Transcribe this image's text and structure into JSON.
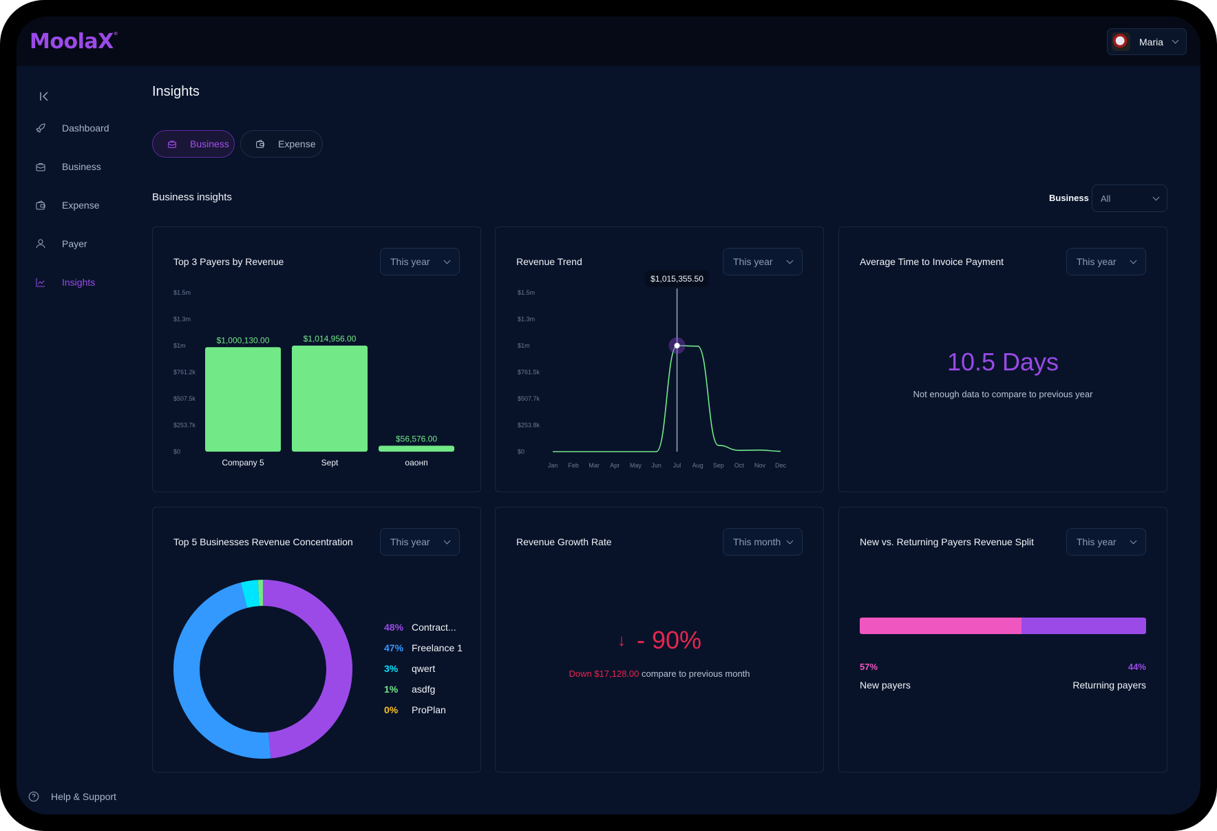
{
  "app": {
    "logo": "MoolaX",
    "logo_mark": "®"
  },
  "user": {
    "name": "Maria"
  },
  "sidebar": {
    "items": [
      {
        "label": "Dashboard",
        "icon": "rocket-icon"
      },
      {
        "label": "Business",
        "icon": "briefcase-icon"
      },
      {
        "label": "Expense",
        "icon": "wallet-icon"
      },
      {
        "label": "Payer",
        "icon": "user-icon"
      },
      {
        "label": "Insights",
        "icon": "trend-chart-icon",
        "active": true
      }
    ],
    "help_label": "Help & Support"
  },
  "page": {
    "title": "Insights",
    "tabs": [
      {
        "label": "Business",
        "active": true
      },
      {
        "label": "Expense",
        "active": false
      }
    ],
    "section_title": "Business insights",
    "filter_label": "Business",
    "filter_value": "All"
  },
  "colors": {
    "accent": "#9b4ae8",
    "bar_green": "#72e887",
    "down_red": "#e8264f",
    "pink": "#f056c0",
    "blue": "#3399ff",
    "cyan": "#00e5ff",
    "yellow": "#ffc21a"
  },
  "cards": {
    "top_payers": {
      "title": "Top 3 Payers by Revenue",
      "period": "This year"
    },
    "revenue_trend": {
      "title": "Revenue Trend",
      "period": "This year"
    },
    "avg_time": {
      "title": "Average Time to Invoice Payment",
      "period": "This year",
      "value": "10.5 Days",
      "note": "Not enough data to compare to previous year"
    },
    "concentration": {
      "title": "Top 5 Businesses Revenue Concentration",
      "period": "This year"
    },
    "growth": {
      "title": "Revenue Growth Rate",
      "period": "This month",
      "arrow": "↓",
      "value": "- 90%",
      "note_down": "Down $17,128.00",
      "note_rest": " compare to previous month"
    },
    "split": {
      "title": "New vs. Returning Payers Revenue Split",
      "period": "This year",
      "new_pct_label": "57%",
      "returning_pct_label": "44%",
      "new_label": "New payers",
      "returning_label": "Returning payers"
    }
  },
  "chart_data": [
    {
      "type": "bar",
      "title": "Top 3 Payers by Revenue",
      "categories": [
        "Company 5",
        "Sept",
        "оаонп"
      ],
      "values": [
        1000130.0,
        1014956.0,
        56576.0
      ],
      "value_labels": [
        "$1,000,130.00",
        "$1,014,956.00",
        "$56,576.00"
      ],
      "yticks": [
        "$0",
        "$253.7k",
        "$507.5k",
        "$761.2k",
        "$1m",
        "$1.3m",
        "$1.5m"
      ],
      "ylim": [
        0,
        1522500
      ],
      "xlabel": "",
      "ylabel": "",
      "grid": false
    },
    {
      "type": "line",
      "title": "Revenue Trend",
      "x": [
        "Jan",
        "Feb",
        "Mar",
        "Apr",
        "May",
        "Jun",
        "Jul",
        "Aug",
        "Sep",
        "Oct",
        "Nov",
        "Dec"
      ],
      "values": [
        0,
        0,
        0,
        0,
        0,
        0,
        1015355.5,
        1010000,
        60000,
        12000,
        15000,
        3000
      ],
      "yticks": [
        "$0",
        "$253.8k",
        "$507.7k",
        "$761.5k",
        "$1m",
        "$1.3m",
        "$1.5m"
      ],
      "ylim": [
        0,
        1523000
      ],
      "tooltip": {
        "x": "Jul",
        "label": "$1,015,355.50"
      },
      "grid": false
    },
    {
      "type": "pie",
      "title": "Top 5 Businesses Revenue Concentration",
      "donut": true,
      "slices": [
        {
          "label": "Contract...",
          "pct_label": "48%",
          "value": 48.6,
          "color": "#9b4ae8"
        },
        {
          "label": "Freelance 1",
          "pct_label": "47%",
          "value": 47.4,
          "color": "#3399ff"
        },
        {
          "label": "qwert",
          "pct_label": "3%",
          "value": 3.1,
          "color": "#00e5ff"
        },
        {
          "label": "asdfg",
          "pct_label": "1%",
          "value": 0.9,
          "color": "#72e887"
        },
        {
          "label": "ProPlan",
          "pct_label": "0%",
          "value": 0.0,
          "color": "#ffc21a"
        }
      ]
    },
    {
      "type": "bar",
      "title": "New vs. Returning Payers Revenue Split",
      "stacked": true,
      "series": [
        {
          "name": "New payers",
          "value": 57,
          "color": "#f056c0"
        },
        {
          "name": "Returning payers",
          "value": 44,
          "color": "#9b4ae8"
        }
      ]
    }
  ]
}
